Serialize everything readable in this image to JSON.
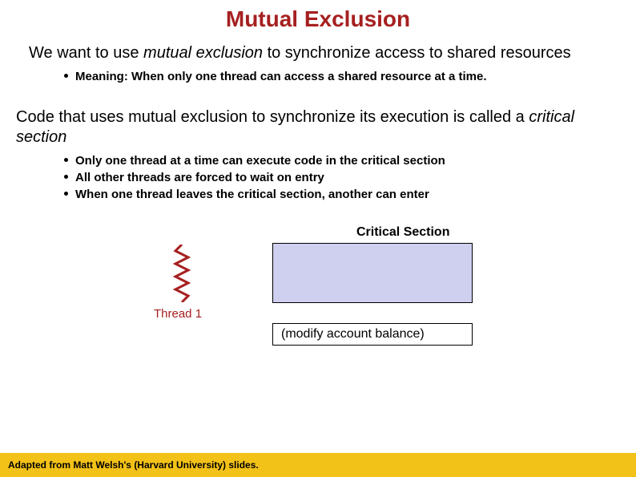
{
  "title": "Mutual Exclusion",
  "para1_pre": "We want to use ",
  "para1_italic": "mutual exclusion",
  "para1_post": " to synchronize access to shared resources",
  "bullets1": [
    "Meaning: When only one thread can access a shared resource at a time."
  ],
  "para2_pre": "Code that uses mutual exclusion to synchronize its execution is called a ",
  "para2_italic": "critical section",
  "bullets2": [
    "Only one thread at a time can execute code in the critical section",
    "All other threads are forced to wait on entry",
    "When one thread leaves the critical section, another can enter"
  ],
  "diagram": {
    "cs_label": "Critical Section",
    "thread_label": "Thread 1",
    "modify_text": "(modify account balance)"
  },
  "footer": "Adapted from Matt Welsh's (Harvard University) slides."
}
